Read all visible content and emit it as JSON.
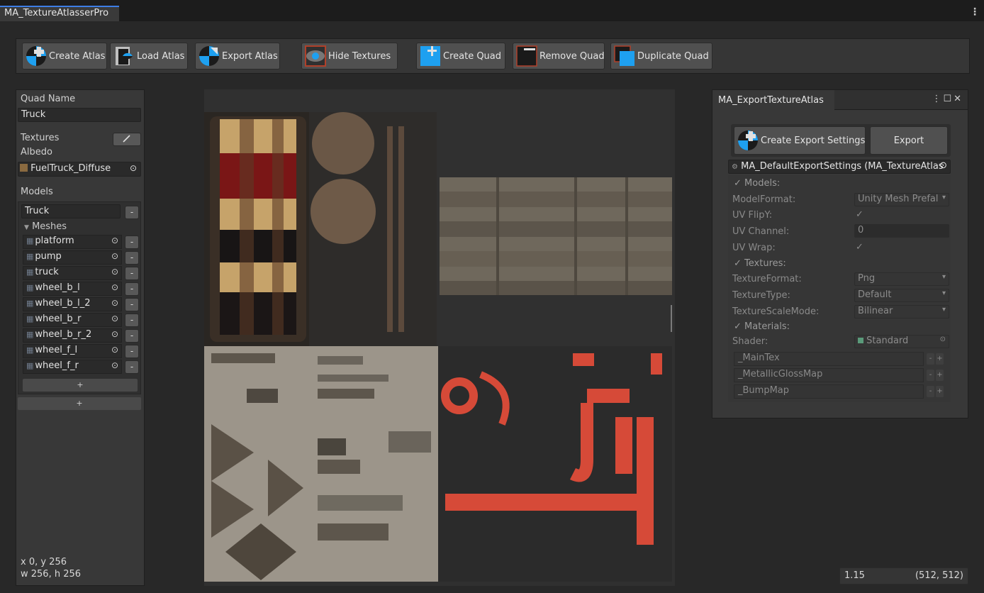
{
  "window": {
    "tab_title": "MA_TextureAtlasserPro"
  },
  "toolbar": {
    "create_atlas": "Create Atlas",
    "load_atlas": "Load Atlas",
    "export_atlas": "Export Atlas",
    "hide_textures": "Hide Textures",
    "create_quad": "Create Quad",
    "remove_quad": "Remove Quad",
    "duplicate_quad": "Duplicate Quad"
  },
  "quad": {
    "name_label": "Quad Name",
    "name_value": "Truck",
    "textures_label": "Textures",
    "albedo_label": "Albedo",
    "albedo_value": "FuelTruck_Diffuse",
    "models_label": "Models",
    "model_name": "Truck",
    "meshes_label": "Meshes",
    "meshes": [
      "platform",
      "pump",
      "truck",
      "wheel_b_l",
      "wheel_b_l_2",
      "wheel_b_r",
      "wheel_b_r_2",
      "wheel_f_l",
      "wheel_f_r"
    ],
    "add_mesh": "+",
    "add_model": "+",
    "remove": "-",
    "position": "x 0, y 256",
    "size": "w 256, h 256"
  },
  "canvas": {
    "zoom": "1.15",
    "atlas_size": "(512, 512)"
  },
  "export_window": {
    "title": "MA_ExportTextureAtlas",
    "create_settings": "Create Export Settings",
    "export": "Export",
    "settings_asset": "MA_DefaultExportSettings (MA_TextureAtlas",
    "models_toggle": "Models:",
    "model_format_label": "ModelFormat:",
    "model_format_value": "Unity Mesh Prefal",
    "uv_flipy_label": "UV FlipY:",
    "uv_flipy_value": true,
    "uv_channel_label": "UV Channel:",
    "uv_channel_value": "0",
    "uv_wrap_label": "UV Wrap:",
    "uv_wrap_value": true,
    "textures_toggle": "Textures:",
    "texture_format_label": "TextureFormat:",
    "texture_format_value": "Png",
    "texture_type_label": "TextureType:",
    "texture_type_value": "Default",
    "texture_scale_label": "TextureScaleMode:",
    "texture_scale_value": "Bilinear",
    "materials_toggle": "Materials:",
    "shader_label": "Shader:",
    "shader_value": "Standard",
    "material_props": [
      "_MainTex",
      "_MetallicGlossMap",
      "_BumpMap"
    ],
    "check": "✓",
    "minus": "-",
    "plus": "+"
  }
}
